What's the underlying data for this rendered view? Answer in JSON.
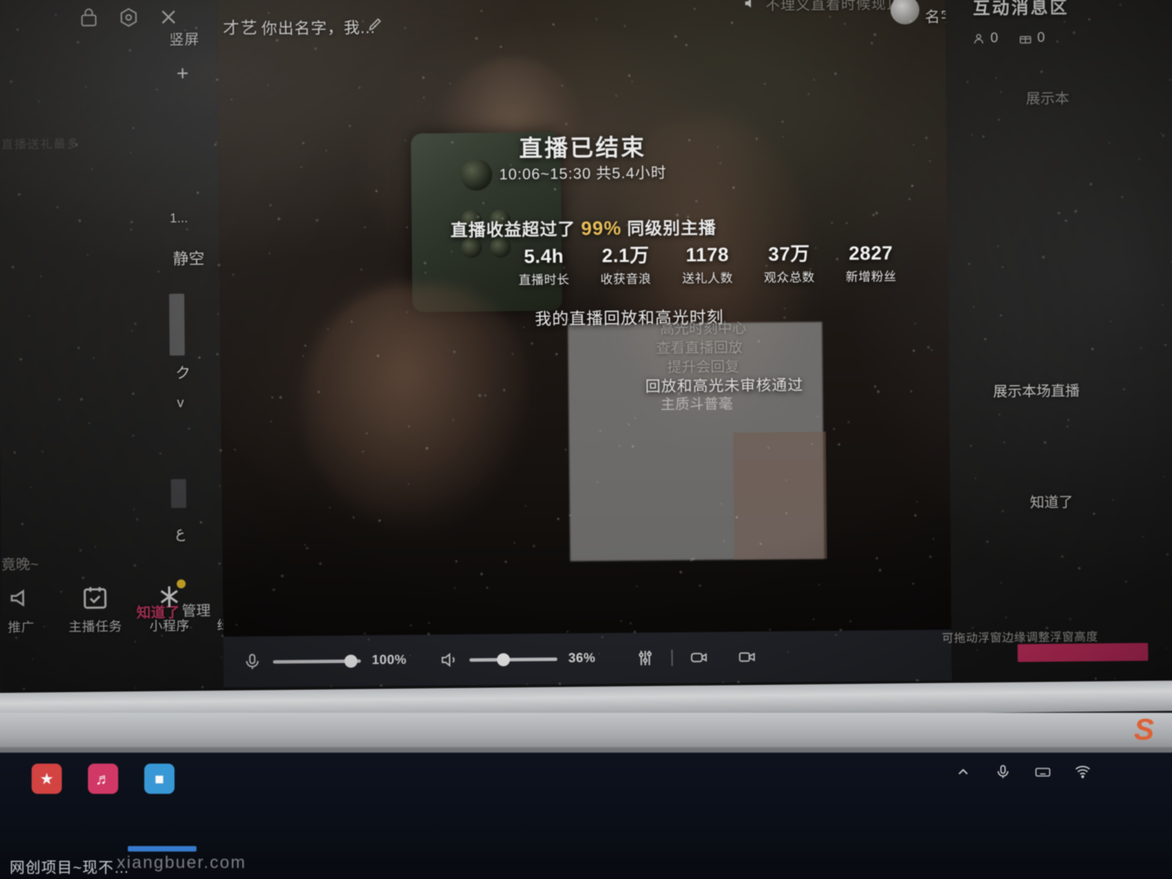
{
  "topbar": {
    "icons": [
      "lock-icon",
      "settings-hexagon-icon",
      "close-icon"
    ],
    "orientation_label": "竖屏",
    "add_label": "+",
    "category": "才艺",
    "room_title": "你出名字，我...",
    "edit_icon": "pencil-icon"
  },
  "live_header": {
    "mute_icon": "speaker-icon",
    "notice": "不理义直看时候现顶眼",
    "avatar": "user-avatar",
    "user_name": "名字与i"
  },
  "left_panel": {
    "faint_top": "直播送礼最多",
    "stubs": [
      "1...",
      "静空",
      "ク",
      "v",
      "ع"
    ],
    "greet": "竟晚~",
    "know_button": "知道了",
    "manage_button": "管理",
    "dock": [
      {
        "label": "推广",
        "icon": "megaphone-icon",
        "badge": false
      },
      {
        "label": "主播任务",
        "icon": "task-check-icon",
        "badge": false
      },
      {
        "label": "小程序",
        "icon": "mini-program-icon",
        "badge": true
      },
      {
        "label": "绿幕大屏",
        "icon": "green-screen-icon",
        "badge": true
      }
    ]
  },
  "overlay": {
    "title": "直播已结束",
    "time_range": "10:06~15:30 共5.4小时",
    "rank_prefix": "直播收益超过了",
    "rank_percent": "99%",
    "rank_suffix": "同级别主播",
    "stats": [
      {
        "value": "5.4h",
        "label": "直播时长"
      },
      {
        "value": "2.1万",
        "label": "收获音浪"
      },
      {
        "value": "1178",
        "label": "送礼人数"
      },
      {
        "value": "37万",
        "label": "观众总数"
      },
      {
        "value": "2827",
        "label": "新增粉丝"
      }
    ],
    "replay_title": "我的直播回放和高光时刻",
    "replay_faint": [
      "高光时刻中心",
      "查看直播回放",
      "提升会回复"
    ],
    "replay_status": "回放和高光未审核通过",
    "replay_sub": "主质斗普毫"
  },
  "controls": {
    "mic_icon": "microphone-icon",
    "mic_value": "100%",
    "speaker_icon": "speaker-volume-icon",
    "speaker_value": "36%",
    "equalizer_icon": "equalizer-icon",
    "camera_icon": "camera-switch-icon",
    "camera2_icon": "video-camera-icon"
  },
  "right_panel": {
    "title": "互动消息区",
    "counts": [
      {
        "icon": "user-icon",
        "value": "0"
      },
      {
        "icon": "gift-icon",
        "value": "0"
      }
    ],
    "lines": [
      "展示本",
      "展示本场直播",
      "知道了"
    ],
    "hint": "可拖动浮窗边缘调整浮窗高度",
    "action_button": ""
  },
  "taskbar": {
    "apps": [
      "红-app",
      "粉-app",
      "蓝-app"
    ],
    "tray_icons": [
      "chevron-up-icon",
      "microphone-tray-icon",
      "keyboard-icon",
      "network-icon"
    ],
    "bottom_text": "网创项目~现不…",
    "watermark": "xiangbuer.com",
    "s_logo": "S"
  }
}
